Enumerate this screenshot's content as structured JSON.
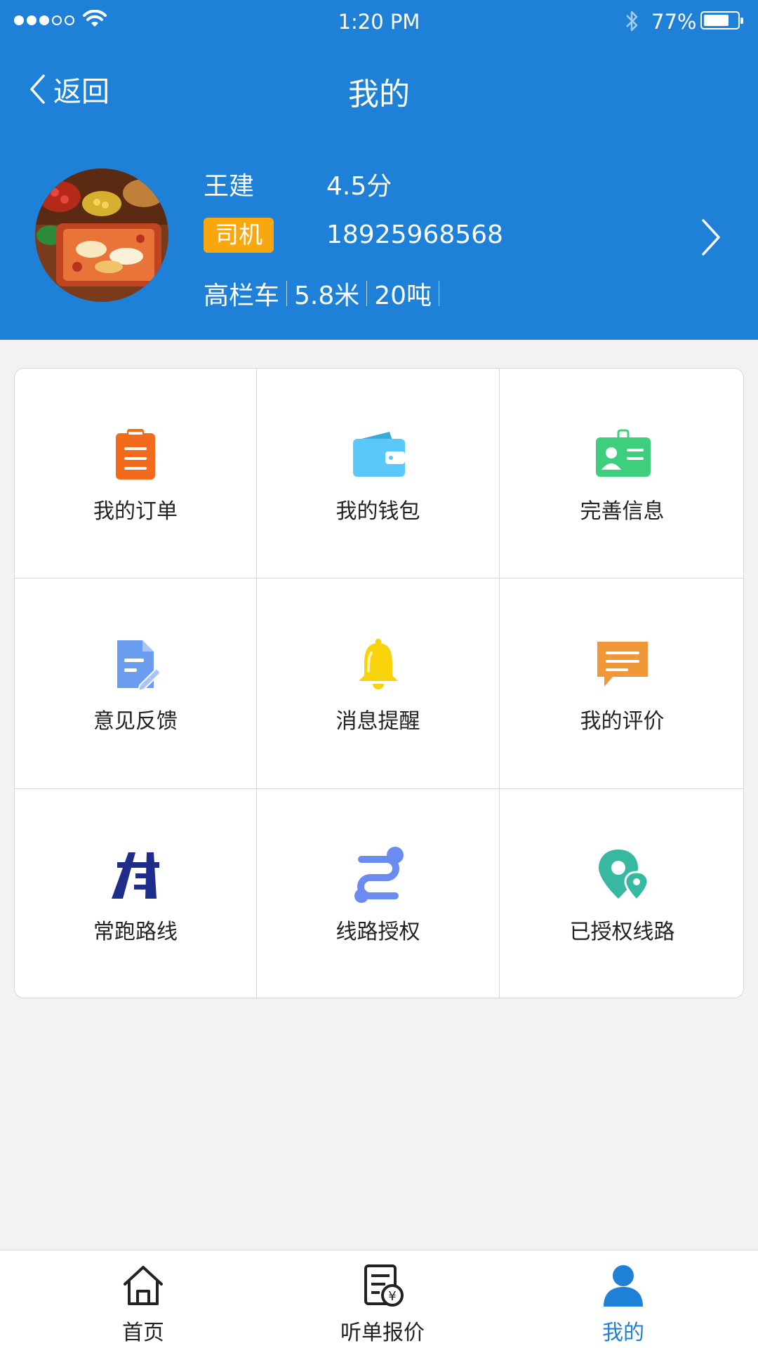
{
  "status_bar": {
    "time": "1:20 PM",
    "battery_percent": "77%",
    "battery_level": 0.77,
    "signal_bars_filled": 3,
    "signal_bars_total": 5
  },
  "nav": {
    "back_label": "返回",
    "title": "我的"
  },
  "profile": {
    "name": "王建",
    "rating": "4.5分",
    "role_badge": "司机",
    "phone": "18925968568",
    "vehicle_type": "高栏车",
    "vehicle_length": "5.8米",
    "vehicle_load": "20吨"
  },
  "menu": {
    "items": [
      {
        "label": "我的订单",
        "icon": "clipboard-icon",
        "color": "#f26b1d"
      },
      {
        "label": "我的钱包",
        "icon": "wallet-icon",
        "color": "#5ac8f8"
      },
      {
        "label": "完善信息",
        "icon": "id-card-icon",
        "color": "#3ecf7e"
      },
      {
        "label": "意见反馈",
        "icon": "feedback-doc-icon",
        "color": "#6a9cf0"
      },
      {
        "label": "消息提醒",
        "icon": "bell-icon",
        "color": "#f8d20a"
      },
      {
        "label": "我的评价",
        "icon": "comment-icon",
        "color": "#f0973a"
      },
      {
        "label": "常跑路线",
        "icon": "road-icon",
        "color": "#1f2d8a"
      },
      {
        "label": "线路授权",
        "icon": "route-icon",
        "color": "#6a8cf0"
      },
      {
        "label": "已授权线路",
        "icon": "location-pins-icon",
        "color": "#37b8a0"
      }
    ]
  },
  "tabbar": {
    "tabs": [
      {
        "label": "首页",
        "icon": "home-icon",
        "active": false
      },
      {
        "label": "听单报价",
        "icon": "quote-doc-icon",
        "active": false
      },
      {
        "label": "我的",
        "icon": "user-icon",
        "active": true
      }
    ]
  },
  "colors": {
    "header_blue": "#1e80d6",
    "badge_orange": "#f8a80e",
    "page_bg": "#f2f2f2"
  }
}
